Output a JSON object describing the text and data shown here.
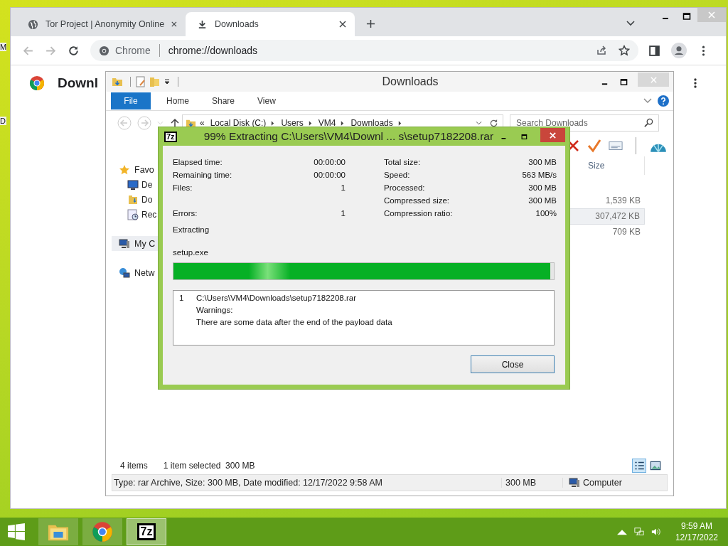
{
  "desktop": {
    "icon_labels": [
      "M",
      "D"
    ]
  },
  "browser": {
    "tabs": [
      {
        "title": "Tor Project | Anonymity Online",
        "kind": "globe",
        "selected": false
      },
      {
        "title": "Downloads",
        "kind": "download",
        "selected": true
      }
    ],
    "omnibox": {
      "chip": "Chrome",
      "url": "chrome://downloads"
    },
    "page_heading": "Downl"
  },
  "explorer": {
    "title": "Downloads",
    "ribbon_tabs": [
      {
        "label": "File",
        "selected": true
      },
      {
        "label": "Home",
        "selected": false
      },
      {
        "label": "Share",
        "selected": false
      },
      {
        "label": "View",
        "selected": false
      }
    ],
    "breadcrumb_overflow": "«",
    "breadcrumb": [
      "Local Disk (C:)",
      "Users",
      "VM4",
      "Downloads"
    ],
    "search": {
      "placeholder": "Search Downloads"
    },
    "nav": [
      {
        "label": "Favo",
        "kind": "star",
        "selected": false,
        "children": [
          {
            "label": "De",
            "kind": "desktop",
            "selected": false
          },
          {
            "label": "Do",
            "kind": "downloads",
            "selected": false
          },
          {
            "label": "Rec",
            "kind": "recent",
            "selected": false
          }
        ]
      },
      {
        "label": "My C",
        "kind": "computer",
        "selected": true
      },
      {
        "label": "Netw",
        "kind": "network",
        "selected": false
      }
    ],
    "columns": [
      "Size"
    ],
    "rows": [
      {
        "size": "1,539 KB",
        "selected": false
      },
      {
        "size": "307,472 KB",
        "selected": true
      },
      {
        "size": "709 KB",
        "selected": false
      }
    ],
    "status": {
      "count": "4 items",
      "selection": "1 item selected  300 MB"
    },
    "details": {
      "info": "Type: rar Archive, Size: 300 MB, Date modified: 12/17/2022 9:58 AM",
      "size": "300 MB",
      "location": "Computer"
    }
  },
  "dialog": {
    "icon_label": "7z",
    "title": "99% Extracting C:\\Users\\VM4\\Downl ... s\\setup7182208.rar",
    "stats": [
      {
        "left": {
          "label": "Elapsed time:",
          "value": "00:00:00"
        },
        "right": {
          "label": "Total size:",
          "value": "300 MB"
        }
      },
      {
        "left": {
          "label": "Remaining time:",
          "value": "00:00:00"
        },
        "right": {
          "label": "Speed:",
          "value": "563 MB/s"
        }
      },
      {
        "left": {
          "label": "Files:",
          "value": "1"
        },
        "right": {
          "label": "Processed:",
          "value": "300 MB"
        }
      },
      {
        "right": {
          "label": "Compressed size:",
          "value": "300 MB"
        }
      },
      {
        "left": {
          "label": "Errors:",
          "value": "1"
        },
        "right": {
          "label": "Compression ratio:",
          "value": "100%"
        }
      }
    ],
    "operation": "Extracting",
    "current_file": "setup.exe",
    "progress": {
      "level": 0.99
    },
    "messages": [
      {
        "number": "1",
        "lines": [
          "C:\\Users\\VM4\\Downloads\\setup7182208.rar",
          "Warnings:",
          "There are some data after the end of the payload data"
        ]
      }
    ],
    "buttons": [
      "Close"
    ]
  },
  "taskbar": {
    "items": [
      {
        "kind": "explorer",
        "active": false
      },
      {
        "kind": "chrome",
        "active": false
      },
      {
        "kind": "sevenzip",
        "label": "7z",
        "active": true
      }
    ],
    "clock": {
      "time": "9:59 AM",
      "date": "12/17/2022"
    }
  }
}
